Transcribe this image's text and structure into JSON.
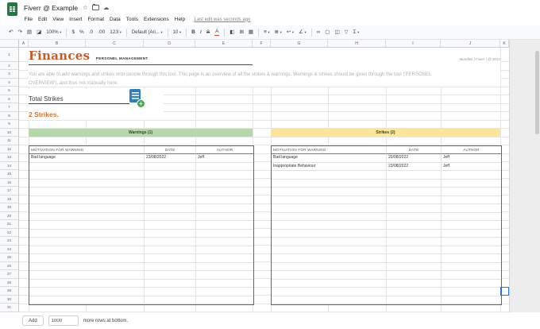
{
  "colors": {
    "sheets_green": "#188038",
    "title_text": "#c75b2c",
    "strikes_text": "#e0712c",
    "warnings_header_bg": "#b6d7a8",
    "strikes_header_bg": "#ffe599",
    "selection_blue": "#1a73e8"
  },
  "titlebar": {
    "title": "Fiverr @ Example",
    "star_icon": "☆",
    "cloud_icon": "☁"
  },
  "menubar": {
    "items": [
      "File",
      "Edit",
      "View",
      "Insert",
      "Format",
      "Data",
      "Tools",
      "Extensions",
      "Help"
    ],
    "last_edit": "Last edit was seconds ago"
  },
  "toolbar": {
    "items": [
      {
        "name": "undo-icon",
        "glyph": "↶"
      },
      {
        "name": "redo-icon",
        "glyph": "↷"
      },
      {
        "name": "print-icon",
        "glyph": "▤"
      },
      {
        "name": "paint-format-icon",
        "glyph": "◪"
      },
      {
        "name": "zoom-select",
        "label": "100%",
        "caret": true
      },
      {
        "type": "divider"
      },
      {
        "name": "format-currency-icon",
        "glyph": "$"
      },
      {
        "name": "format-percent-icon",
        "glyph": "%"
      },
      {
        "name": "decrease-decimals-icon",
        "glyph": ".0"
      },
      {
        "name": "increase-decimals-icon",
        "glyph": ".00"
      },
      {
        "name": "more-formats-icon",
        "glyph": "123",
        "caret": true
      },
      {
        "type": "divider"
      },
      {
        "name": "font-select",
        "label": "Default (Ari...",
        "caret": true
      },
      {
        "type": "divider"
      },
      {
        "name": "font-size-select",
        "label": "10",
        "caret": true
      },
      {
        "type": "divider"
      },
      {
        "name": "bold-icon",
        "glyph": "B",
        "style": "bold"
      },
      {
        "name": "italic-icon",
        "glyph": "I",
        "style": "italic"
      },
      {
        "name": "strikethrough-icon",
        "glyph": "S",
        "style": "strike"
      },
      {
        "name": "text-color-icon",
        "glyph": "A",
        "colorbar": "#e8452c"
      },
      {
        "type": "divider"
      },
      {
        "name": "fill-color-icon",
        "glyph": "◧"
      },
      {
        "name": "borders-icon",
        "glyph": "⊞"
      },
      {
        "name": "merge-cells-icon",
        "glyph": "▦"
      },
      {
        "type": "divider"
      },
      {
        "name": "horizontal-align-icon",
        "glyph": "≡",
        "caret": true
      },
      {
        "name": "vertical-align-icon",
        "glyph": "≣",
        "caret": true
      },
      {
        "name": "text-wrap-icon",
        "glyph": "↩",
        "caret": true
      },
      {
        "name": "text-rotation-icon",
        "glyph": "∠",
        "caret": true
      },
      {
        "type": "divider"
      },
      {
        "name": "insert-link-icon",
        "glyph": "∞"
      },
      {
        "name": "insert-comment-icon",
        "glyph": "▢"
      },
      {
        "name": "insert-chart-icon",
        "glyph": "◫"
      },
      {
        "name": "create-filter-icon",
        "glyph": "▽"
      },
      {
        "name": "functions-icon",
        "glyph": "Σ",
        "caret": true
      }
    ]
  },
  "grid": {
    "columns": [
      "A",
      "B",
      "C",
      "D",
      "E",
      "F",
      "G",
      "H",
      "I",
      "J",
      "K"
    ],
    "row_count": 31
  },
  "sheet": {
    "title": "Finances",
    "subtitle": "PERSONEL MANAGEMENT",
    "credit": "Bundles | Fiverr | @ 2022",
    "description_line1": "You are able to add warnings and strikes onto people through this tool. This page is an overview of all the strikes & warnings. Warnings & strikes should be given through the tool ('PERSONEL",
    "description_line2": "OVERVIEW'), and thus not manually here.",
    "total_strikes_label": "Total Strikes",
    "strikes_value": "2 Strikes.",
    "warnings": {
      "title": "Warnings (1)",
      "columns": [
        "MOTIVATION FOR WARNING",
        "DATE",
        "AUTHOR"
      ],
      "rows": [
        [
          "Bad language",
          "23/08/2022",
          "Jeff"
        ]
      ]
    },
    "strikes": {
      "title": "Strikes (2)",
      "columns": [
        "MOTIVATION FOR WARNING",
        "DATE",
        "AUTHOR"
      ],
      "rows": [
        [
          "Bad language",
          "20/08/2022",
          "Jeff"
        ],
        [
          "Inappropriate Behaviour",
          "23/08/2022",
          "Jeff"
        ]
      ]
    }
  },
  "footer": {
    "add_button": "Add",
    "rows_input": "1000",
    "suffix": "more rows at bottom."
  }
}
